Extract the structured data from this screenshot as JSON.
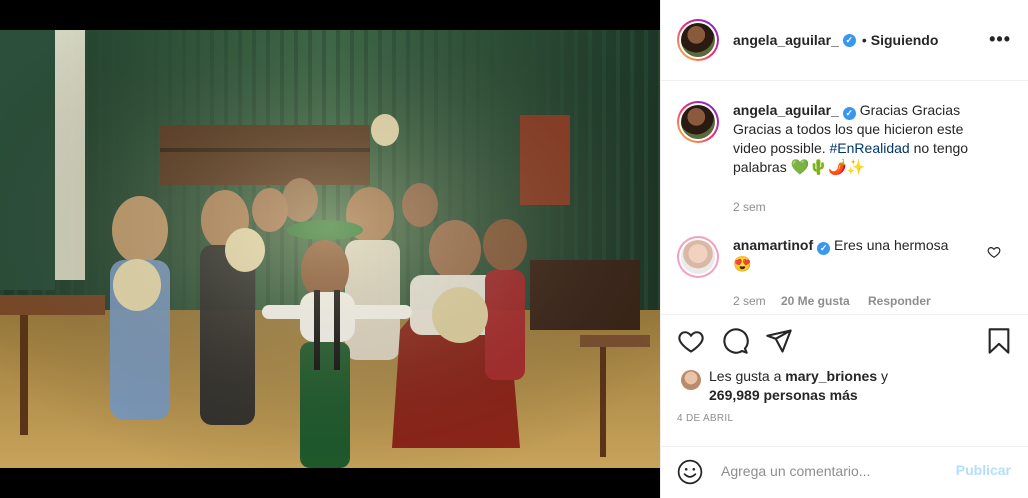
{
  "post": {
    "username": "angela_aguilar_",
    "separator": "•",
    "follow_status": "Siguiendo",
    "more_label": "•••"
  },
  "caption": {
    "username": "angela_aguilar_",
    "text": "Gracias Gracias Gracias a todos los que hicieron este video possible.",
    "hashtag": "#EnRealidad",
    "text_after": "no tengo palabras",
    "emojis": "💚🌵🌶️✨",
    "time": "2 sem"
  },
  "comment": {
    "username": "anamartinof",
    "text": "Eres una hermosa",
    "emoji": "😍",
    "time": "2 sem",
    "likes": "20 Me gusta",
    "reply": "Responder"
  },
  "likes": {
    "prefix": "Les gusta a",
    "user": "mary_briones",
    "conj": "y",
    "count": "269,989 personas más"
  },
  "date": "4 DE ABRIL",
  "add_comment": {
    "placeholder": "Agrega un comentario...",
    "publish": "Publicar"
  },
  "icons": {
    "verified": "verified-badge-icon",
    "more": "more-options-icon",
    "like": "heart-icon",
    "comment": "comment-icon",
    "share": "share-icon",
    "save": "bookmark-icon",
    "emoji": "smiley-icon"
  },
  "colors": {
    "verified": "#3897f0",
    "hashtag": "#00376b",
    "publish_disabled": "#b2dffc",
    "muted": "#8e8e8e"
  }
}
